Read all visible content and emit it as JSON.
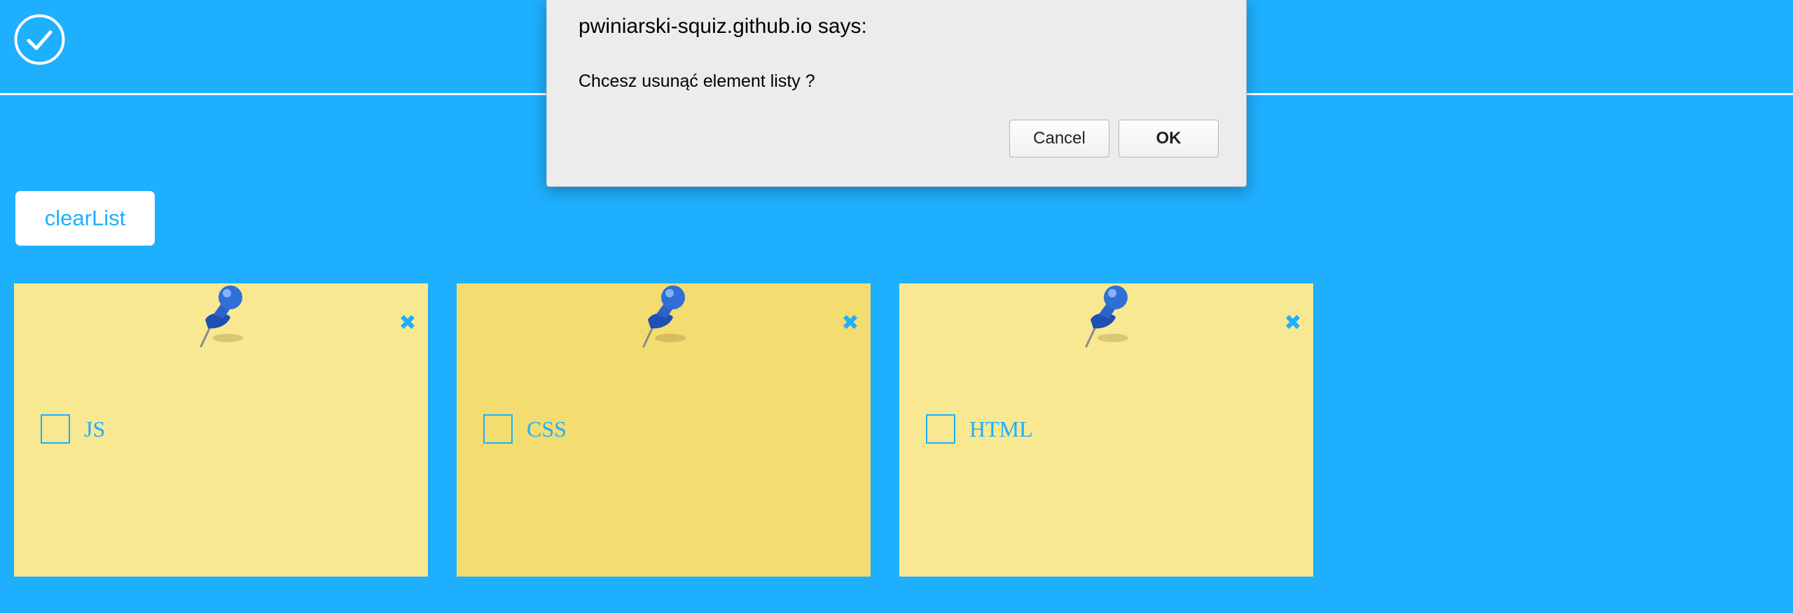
{
  "header": {
    "logo_icon": "check-circle-icon"
  },
  "toolbar": {
    "clear_label": "clearList"
  },
  "notes": [
    {
      "label": "JS",
      "checked": false,
      "pin_icon": "pushpin-icon",
      "close_icon": "close-x-icon",
      "background": "#f8e891"
    },
    {
      "label": "CSS",
      "checked": false,
      "pin_icon": "pushpin-icon",
      "close_icon": "close-x-icon",
      "background": "#f3dc70"
    },
    {
      "label": "HTML",
      "checked": false,
      "pin_icon": "pushpin-icon",
      "close_icon": "close-x-icon",
      "background": "#f8e891"
    }
  ],
  "dialog": {
    "title": "pwiniarski-squiz.github.io says:",
    "message": "Chcesz usunąć element listy ?",
    "cancel_label": "Cancel",
    "ok_label": "OK"
  },
  "colors": {
    "background": "#1eaffe",
    "accent": "#1eaffe",
    "note": "#f8e891",
    "note_active": "#f3dc70",
    "dialog": "#ececec"
  }
}
